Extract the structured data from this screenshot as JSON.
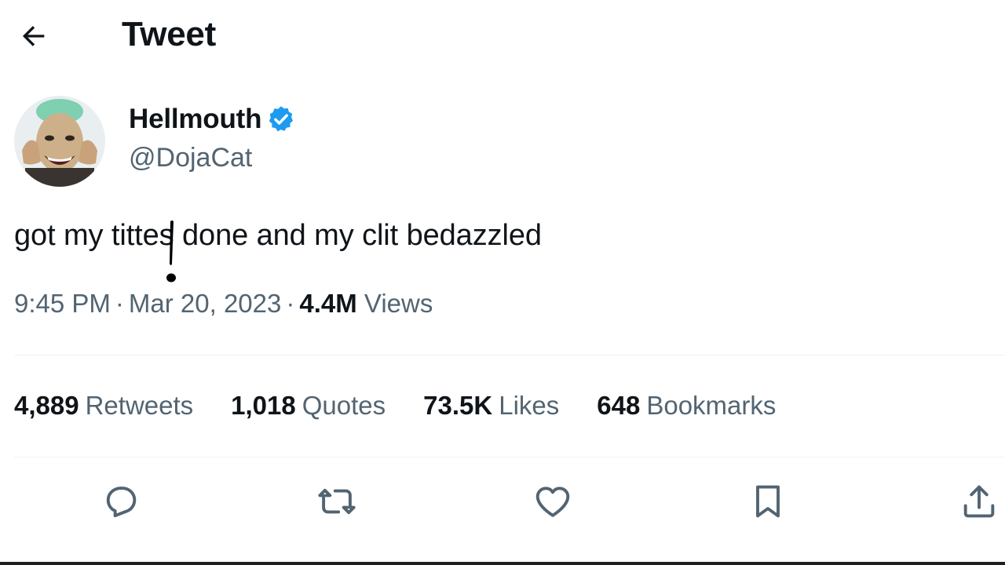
{
  "header": {
    "back_icon": "arrow-left-icon",
    "title": "Tweet"
  },
  "author": {
    "display_name": "Hellmouth",
    "handle": "@DojaCat",
    "verified_icon": "verified-badge-icon",
    "verified_color": "#1d9bf0"
  },
  "tweet": {
    "text": "got my tittes done and my clit bedazzled",
    "time": "9:45 PM",
    "date": "Mar 20, 2023",
    "views_count": "4.4M",
    "views_label": "Views",
    "separator": "·"
  },
  "stats": [
    {
      "count": "4,889",
      "label": "Retweets"
    },
    {
      "count": "1,018",
      "label": "Quotes"
    },
    {
      "count": "73.5K",
      "label": "Likes"
    },
    {
      "count": "648",
      "label": "Bookmarks"
    }
  ],
  "actions": [
    {
      "name": "reply",
      "icon": "reply-icon"
    },
    {
      "name": "retweet",
      "icon": "retweet-icon"
    },
    {
      "name": "like",
      "icon": "heart-icon"
    },
    {
      "name": "bookmark",
      "icon": "bookmark-icon"
    },
    {
      "name": "share",
      "icon": "share-icon"
    }
  ],
  "colors": {
    "primary_text": "#0f1419",
    "secondary_text": "#536471",
    "divider": "#eff3f4",
    "verified": "#1d9bf0"
  }
}
